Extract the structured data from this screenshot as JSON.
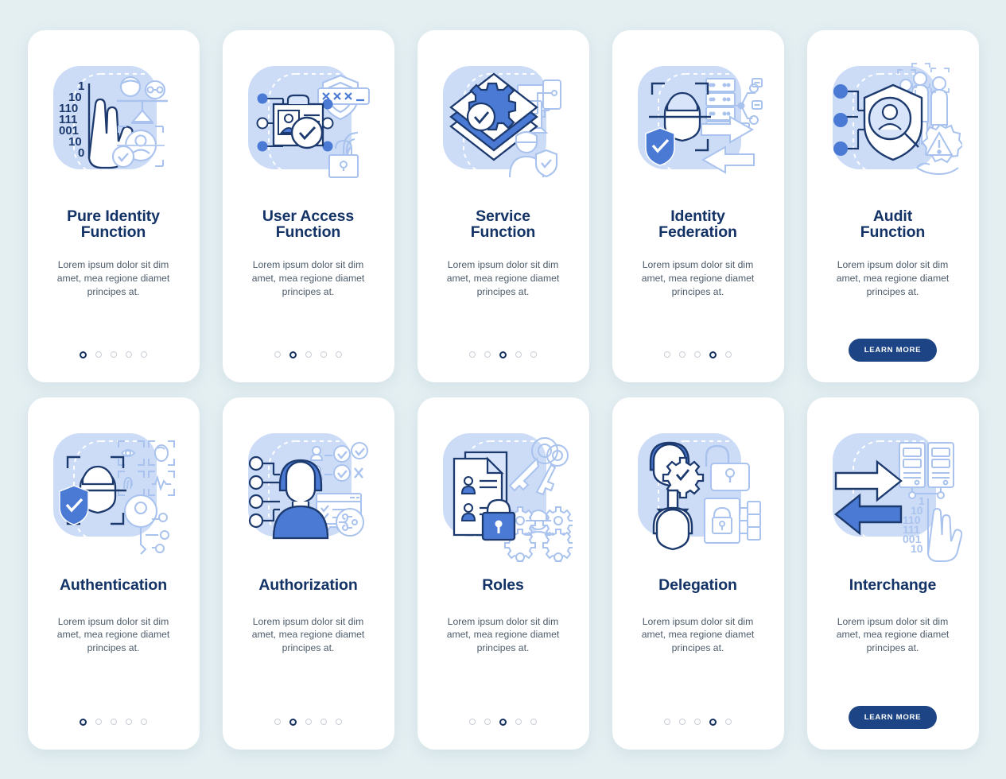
{
  "theme": {
    "page_background": "#e4eff2",
    "card_background": "#ffffff",
    "title_color": "#133266",
    "body_color": "#4d5c6b",
    "accent_navy": "#1d4484",
    "accent_blue": "#3f74d0",
    "art_panel_bg": "#ccdcf7",
    "dot_inactive": "#c9ced6",
    "dot_active": "#16305e"
  },
  "shared": {
    "description": "Lorem ipsum dolor sit dim amet, mea regione diamet principes at.",
    "learn_more_label": "LEARN MORE",
    "dot_count": 5
  },
  "cards": [
    {
      "id": "pure-identity-function",
      "title": "Pure Identity Function",
      "title_lines": [
        "Pure Identity",
        "Function"
      ],
      "description": "Lorem ipsum dolor sit dim amet, mea regione diamet principes at.",
      "active_dot": 1,
      "has_button": false,
      "icon": "hand-binary-faces-scan-icon"
    },
    {
      "id": "user-access-function",
      "title": "User Access Function",
      "title_lines": [
        "User Access",
        "Function"
      ],
      "description": "Lorem ipsum dolor sit dim amet, mea regione diamet principes at.",
      "active_dot": 2,
      "has_button": false,
      "icon": "id-card-shield-password-fingerprint-icon"
    },
    {
      "id": "service-function",
      "title": "Service Function",
      "title_lines": [
        "Service",
        "Function"
      ],
      "description": "Lorem ipsum dolor sit dim amet, mea regione diamet principes at.",
      "active_dot": 3,
      "has_button": false,
      "icon": "gear-layers-devices-user-icon"
    },
    {
      "id": "identity-federation",
      "title": "Identity Federation",
      "title_lines": [
        "Identity",
        "Federation"
      ],
      "description": "Lorem ipsum dolor sit dim amet, mea regione diamet principes at.",
      "active_dot": 4,
      "has_button": false,
      "icon": "face-scan-server-arrows-icon"
    },
    {
      "id": "audit-function",
      "title": "Audit Function",
      "title_lines": [
        "Audit",
        "Function"
      ],
      "description": "Lorem ipsum dolor sit dim amet, mea regione diamet principes at.",
      "active_dot": 5,
      "has_button": true,
      "icon": "shield-user-people-warning-icon"
    },
    {
      "id": "authentication",
      "title": "Authentication",
      "title_lines": [
        "Authentication"
      ],
      "description": "Lorem ipsum dolor sit dim amet, mea regione diamet principes at.",
      "active_dot": 1,
      "has_button": false,
      "icon": "face-scan-biometrics-key-icon"
    },
    {
      "id": "authorization",
      "title": "Authorization",
      "title_lines": [
        "Authorization"
      ],
      "description": "Lorem ipsum dolor sit dim amet, mea regione diamet principes at.",
      "active_dot": 2,
      "has_button": false,
      "icon": "user-permissions-checklist-icon"
    },
    {
      "id": "roles",
      "title": "Roles",
      "title_lines": [
        "Roles"
      ],
      "description": "Lorem ipsum dolor sit dim amet, mea regione diamet principes at.",
      "active_dot": 3,
      "has_button": false,
      "icon": "document-lock-keys-gears-icon"
    },
    {
      "id": "delegation",
      "title": "Delegation",
      "title_lines": [
        "Delegation"
      ],
      "description": "Lorem ipsum dolor sit dim amet, mea regione diamet principes at.",
      "active_dot": 4,
      "has_button": false,
      "icon": "user-transfer-arrow-locks-icon"
    },
    {
      "id": "interchange",
      "title": "Interchange",
      "title_lines": [
        "Interchange"
      ],
      "description": "Lorem ipsum dolor sit dim amet, mea regione diamet principes at.",
      "active_dot": 5,
      "has_button": true,
      "icon": "arrows-servers-binary-hand-icon"
    }
  ]
}
